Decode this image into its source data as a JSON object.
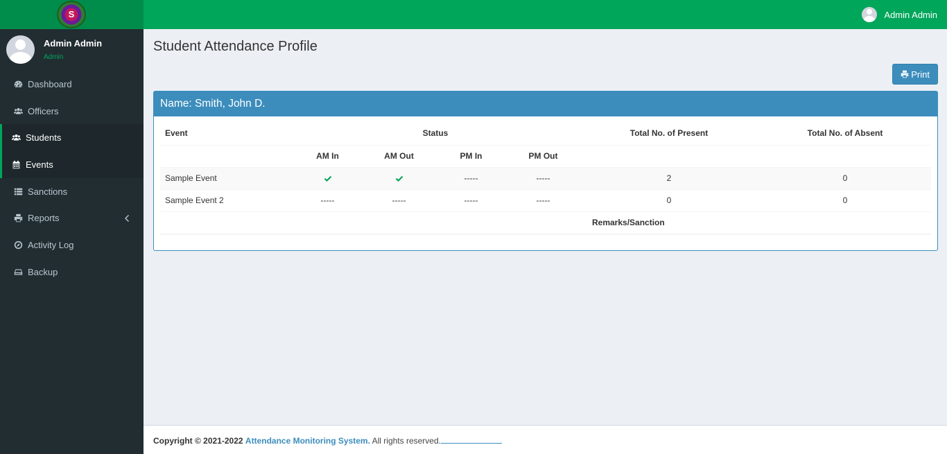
{
  "app": {
    "logo_text": "S"
  },
  "header": {
    "user_name": "Admin Admin"
  },
  "sidebar": {
    "user": {
      "name": "Admin Admin",
      "role": "Admin"
    },
    "items": [
      {
        "label": "Dashboard",
        "icon": "dashboard-icon",
        "active": false
      },
      {
        "label": "Officers",
        "icon": "users-icon",
        "active": false
      },
      {
        "label": "Students",
        "icon": "users-icon",
        "active": true
      },
      {
        "label": "Events",
        "icon": "calendar-icon",
        "active": true
      },
      {
        "label": "Sanctions",
        "icon": "list-icon",
        "active": false
      },
      {
        "label": "Reports",
        "icon": "print-icon",
        "active": false,
        "has_submenu": true
      },
      {
        "label": "Activity Log",
        "icon": "compass-icon",
        "active": false
      },
      {
        "label": "Backup",
        "icon": "hdd-icon",
        "active": false
      }
    ]
  },
  "main": {
    "page_title": "Student Attendance Profile",
    "print_label": "Print",
    "box_title": "Name: Smith, John D.",
    "table": {
      "headers": {
        "event": "Event",
        "status": "Status",
        "total_present": "Total No. of Present",
        "total_absent": "Total No. of Absent"
      },
      "sub_headers": [
        "AM In",
        "AM Out",
        "PM In",
        "PM Out"
      ],
      "rows": [
        {
          "event": "Sample Event",
          "am_in": "check",
          "am_out": "check",
          "pm_in": "-----",
          "pm_out": "-----",
          "present": "2",
          "absent": "0"
        },
        {
          "event": "Sample Event 2",
          "am_in": "-----",
          "am_out": "-----",
          "pm_in": "-----",
          "pm_out": "-----",
          "present": "0",
          "absent": "0"
        }
      ],
      "remarks_label": "Remarks/Sanction"
    }
  },
  "footer": {
    "copyright": "Copyright © 2021-2022",
    "brand": "Attendance Monitoring System.",
    "rights": "All rights reserved."
  },
  "colors": {
    "topbar": "#00a65a",
    "sidebar": "#222d32",
    "primary": "#3c8dbc",
    "check": "#00a65a"
  }
}
